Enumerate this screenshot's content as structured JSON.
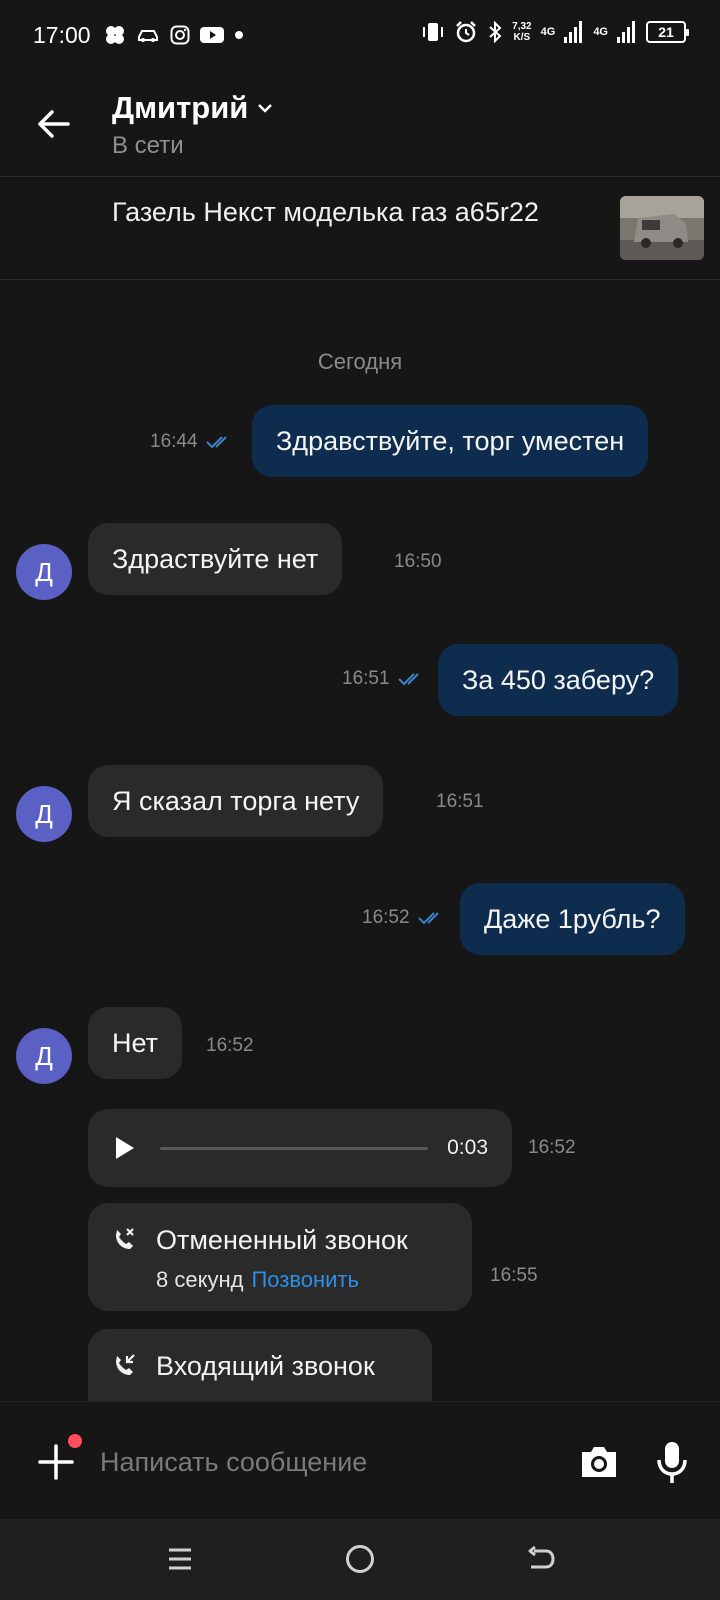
{
  "status_bar": {
    "time": "17:00",
    "speed_value": "7,32",
    "speed_unit": "K/S",
    "net1": "4G",
    "net2": "4G",
    "battery": "21",
    "icons": [
      "flower-icon",
      "car-icon",
      "instagram-icon",
      "youtube-icon",
      "dot-icon",
      "vibrate-icon",
      "alarm-icon",
      "bluetooth-icon",
      "signal-icon"
    ]
  },
  "header": {
    "name": "Дмитрий",
    "status": "В сети",
    "icons": [
      "back-arrow-icon",
      "chevron-down-icon"
    ]
  },
  "listing": {
    "title": "Газель Некст моделька газ a65r22"
  },
  "chat": {
    "date_separator": "Сегодня",
    "avatar_letter": "Д",
    "messages": [
      {
        "dir": "out",
        "text": "Здравствуйте, торг уместен",
        "time": "16:44"
      },
      {
        "dir": "in",
        "text": "Здраствуйте нет",
        "time": "16:50"
      },
      {
        "dir": "out",
        "text": "За 450 заберу?",
        "time": "16:51"
      },
      {
        "dir": "in",
        "text": "Я сказал торга нету",
        "time": "16:51"
      },
      {
        "dir": "out",
        "text": "Даже 1рубль?",
        "time": "16:52"
      },
      {
        "dir": "in",
        "text": "Нет",
        "time": "16:52"
      }
    ],
    "voice": {
      "duration": "0:03",
      "time": "16:52"
    },
    "calls": [
      {
        "title": "Отмененный звонок",
        "duration": "8 секунд",
        "action": "Позвонить",
        "time": "16:55"
      },
      {
        "title": "Входящий звонок",
        "duration": "",
        "action": "",
        "time": ""
      }
    ]
  },
  "input": {
    "placeholder": "Написать сообщение",
    "value": ""
  },
  "colors": {
    "background": "#161616",
    "outgoing_bubble": "#0e2c4d",
    "incoming_bubble": "#2a2a2a",
    "avatar": "#5b60c4",
    "link": "#2e8fe8",
    "read_ticks": "#3c82c9",
    "notification_dot": "#ff4d5e"
  }
}
